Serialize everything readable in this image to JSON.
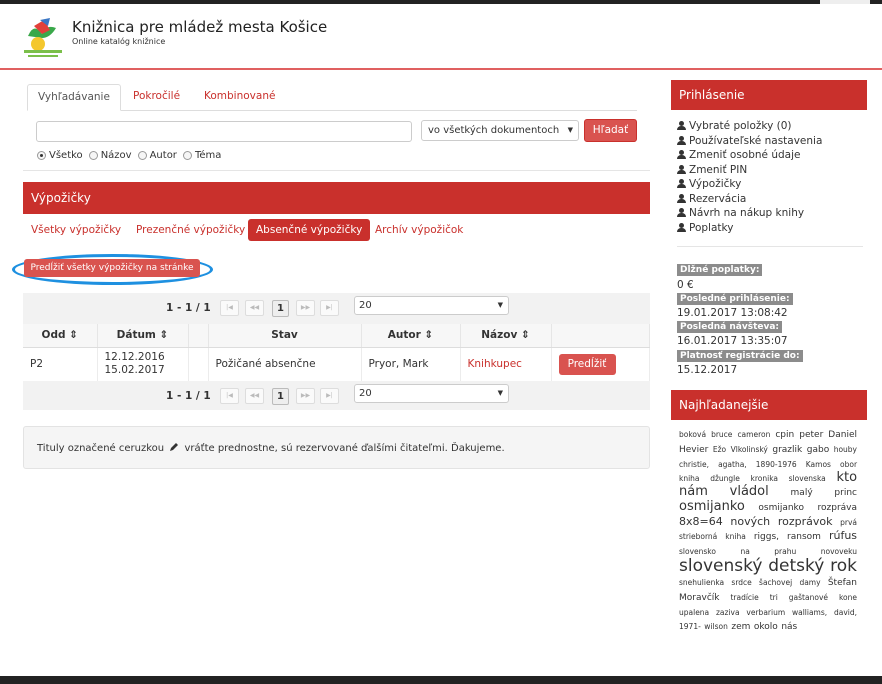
{
  "header": {
    "title": "Knižnica pre mládež mesta Košice",
    "subtitle": "Online katalóg knižnice",
    "logo_icon": "library-logo-icon"
  },
  "search": {
    "tabs": [
      "Vyhľadávanie",
      "Pokročilé",
      "Kombinované"
    ],
    "active_tab": 0,
    "query_value": "",
    "scope_value": "vo všetkých dokumentoch",
    "button_label": "Hľadať",
    "radio_options": [
      "Všetko",
      "Názov",
      "Autor",
      "Téma"
    ],
    "radio_selected": 0
  },
  "loans": {
    "title": "Výpožičky",
    "subtabs": [
      "Všetky výpožičky",
      "Prezenčné výpožičky",
      "Absenčné výpožičky",
      "Archív výpožičok"
    ],
    "active_subtab": 2,
    "renew_all_label": "Predĺžiť všetky výpožičky na stránke",
    "pager": {
      "count": "1 - 1 / 1",
      "page": "1",
      "page_size": "20",
      "nav_icons": [
        "first-page-icon",
        "prev-page-icon",
        "next-page-icon",
        "last-page-icon"
      ]
    },
    "columns": [
      "Odd ⇕",
      "Dátum ⇕",
      "",
      "Stav",
      "Autor ⇕",
      "Názov ⇕",
      ""
    ],
    "rows": [
      {
        "dept": "P2",
        "date_from": "12.12.2016",
        "date_to": "15.02.2017",
        "status": "Požičané absenčne",
        "author": "Pryor, Mark",
        "title": "Knihkupec",
        "action": "Predĺžiť"
      }
    ]
  },
  "notice": {
    "text_before": "Tituly označené ceruzkou",
    "text_after": "vráťte prednostne, sú rezervované ďalšími čitateľmi. Ďakujeme.",
    "icon": "pencil-icon"
  },
  "sidebar": {
    "login_title": "Prihlásenie",
    "menu": [
      "Vybraté položky (0)",
      "Používateľské nastavenia",
      "Zmeniť osobné údaje",
      "Zmeniť PIN",
      "Výpožičky",
      "Rezervácia",
      "Návrh na nákup knihy",
      "Poplatky"
    ],
    "menu_icon": "user-icon",
    "info": [
      {
        "label": "Dlžné poplatky:",
        "value": "0 €"
      },
      {
        "label": "Posledné prihlásenie:",
        "value": "19.01.2017 13:08:42"
      },
      {
        "label": "Posledná návšteva:",
        "value": "16.01.2017 13:35:07"
      },
      {
        "label": "Platnosť registrácie do:",
        "value": "15.12.2017"
      }
    ],
    "top_title": "Najhľadanejšie",
    "tags": [
      {
        "t": "boková",
        "s": 0
      },
      {
        "t": "bruce",
        "s": 0
      },
      {
        "t": "cameron",
        "s": 0
      },
      {
        "t": "cpin",
        "s": 1
      },
      {
        "t": "peter",
        "s": 1
      },
      {
        "t": "Daniel",
        "s": 1
      },
      {
        "t": "Hevier",
        "s": 1
      },
      {
        "t": "Ežo",
        "s": 0
      },
      {
        "t": "Vlkolinský",
        "s": 0
      },
      {
        "t": "grazlik",
        "s": 1
      },
      {
        "t": "gabo",
        "s": 1
      },
      {
        "t": "houby",
        "s": 0
      },
      {
        "t": "christie,",
        "s": 0
      },
      {
        "t": "agatha,",
        "s": 0
      },
      {
        "t": "1890-1976",
        "s": 0
      },
      {
        "t": "Kamos",
        "s": 0
      },
      {
        "t": "obor",
        "s": 0
      },
      {
        "t": "kniha",
        "s": 0
      },
      {
        "t": "džungle",
        "s": 0
      },
      {
        "t": "kronika",
        "s": 0
      },
      {
        "t": "slovenska",
        "s": 0
      },
      {
        "t": "kto",
        "s": 3
      },
      {
        "t": "nám",
        "s": 3
      },
      {
        "t": "vládol",
        "s": 3
      },
      {
        "t": "malý",
        "s": 1
      },
      {
        "t": "princ",
        "s": 1
      },
      {
        "t": "osmijanko",
        "s": 3
      },
      {
        "t": "osmijanko",
        "s": 1
      },
      {
        "t": "rozpráva",
        "s": 1
      },
      {
        "t": "8x8=64",
        "s": 2
      },
      {
        "t": "nových",
        "s": 2
      },
      {
        "t": "rozprávok",
        "s": 2
      },
      {
        "t": "prvá",
        "s": 0
      },
      {
        "t": "strieborná",
        "s": 0
      },
      {
        "t": "kniha",
        "s": 0
      },
      {
        "t": "riggs,",
        "s": 1
      },
      {
        "t": "ransom",
        "s": 1
      },
      {
        "t": "rúfus",
        "s": 2
      },
      {
        "t": "slovensko",
        "s": 0
      },
      {
        "t": "na",
        "s": 0
      },
      {
        "t": "prahu",
        "s": 0
      },
      {
        "t": "novoveku",
        "s": 0
      },
      {
        "t": "slovenský",
        "s": 4
      },
      {
        "t": "detský",
        "s": 4
      },
      {
        "t": "rok",
        "s": 4
      },
      {
        "t": "snehulienka",
        "s": 0
      },
      {
        "t": "srdce",
        "s": 0
      },
      {
        "t": "šachovej",
        "s": 0
      },
      {
        "t": "damy",
        "s": 0
      },
      {
        "t": "Štefan",
        "s": 1
      },
      {
        "t": "Moravčík",
        "s": 1
      },
      {
        "t": "tradície",
        "s": 0
      },
      {
        "t": "tri",
        "s": 0
      },
      {
        "t": "gaštanové",
        "s": 0
      },
      {
        "t": "kone",
        "s": 0
      },
      {
        "t": "upalena",
        "s": 0
      },
      {
        "t": "zaziva",
        "s": 0
      },
      {
        "t": "verbarium",
        "s": 0
      },
      {
        "t": "walliams,",
        "s": 0
      },
      {
        "t": "david,",
        "s": 0
      },
      {
        "t": "1971-",
        "s": 0
      },
      {
        "t": "wilson",
        "s": 0
      },
      {
        "t": "zem",
        "s": 1
      },
      {
        "t": "okolo",
        "s": 1
      },
      {
        "t": "nás",
        "s": 1
      }
    ]
  },
  "colors": {
    "accent": "#c9302c",
    "button": "#d9534f",
    "highlight_ellipse": "#1e90e0"
  }
}
